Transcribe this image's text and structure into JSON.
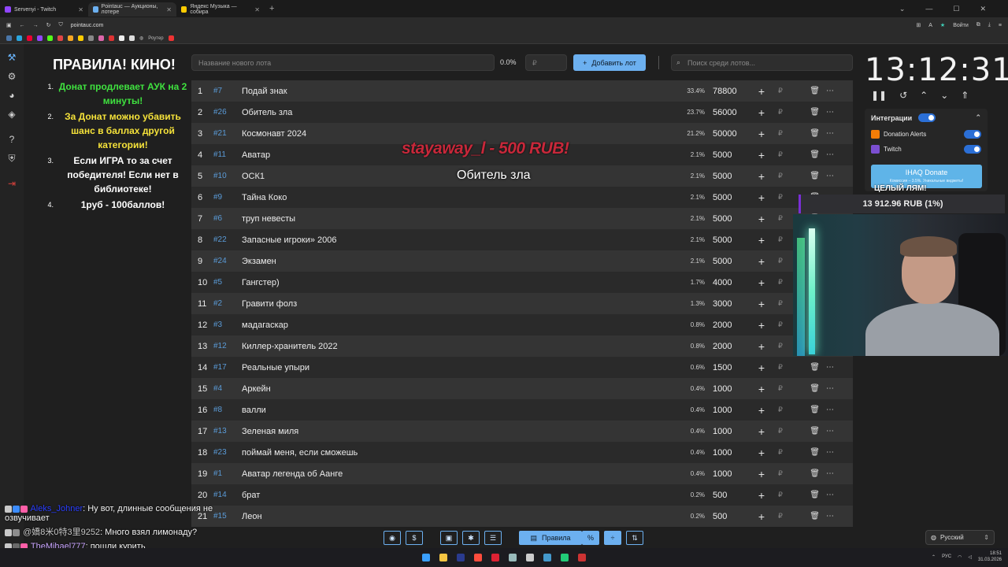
{
  "browser": {
    "tabs": [
      {
        "title": "Servenyi - Twitch",
        "color": "#9146ff",
        "active": false
      },
      {
        "title": "Pointauc — Аукционы, лотере",
        "color": "#6cb0f0",
        "active": true
      },
      {
        "title": "Яндекс Музыка — собира",
        "color": "#ffcc00",
        "active": false
      }
    ],
    "url": "pointauc.com",
    "login_label": "Войти",
    "bookmark_router": "Роутер"
  },
  "rules": {
    "title": "ПРАВИЛА! КИНО!",
    "items": [
      {
        "num": "1.",
        "text": "Донат продлевает АУК на 2 минуты!"
      },
      {
        "num": "2.",
        "text": "За Донат можно убавить шанс в баллах другой категории!"
      },
      {
        "num": "3.",
        "text": "Если ИГРА то за счет победителя! Если нет в библиотеке!"
      },
      {
        "num": "4.",
        "text": "1руб - 100баллов!"
      }
    ]
  },
  "toolbar": {
    "new_lot_placeholder": "Название нового лота",
    "percent": "0.0%",
    "amount_placeholder": "₽",
    "add_button": "Добавить лот",
    "search_placeholder": "Поиск среди лотов..."
  },
  "lots": [
    {
      "rank": "1",
      "id": "#7",
      "name": "Подай знак",
      "chance": "33.4%",
      "sum": "78800"
    },
    {
      "rank": "2",
      "id": "#26",
      "name": "Обитель зла",
      "chance": "23.7%",
      "sum": "56000"
    },
    {
      "rank": "3",
      "id": "#21",
      "name": "Космонавт 2024",
      "chance": "21.2%",
      "sum": "50000"
    },
    {
      "rank": "4",
      "id": "#11",
      "name": "Аватар",
      "chance": "2.1%",
      "sum": "5000"
    },
    {
      "rank": "5",
      "id": "#10",
      "name": "ОСК1",
      "chance": "2.1%",
      "sum": "5000"
    },
    {
      "rank": "6",
      "id": "#9",
      "name": "Тайна Коко",
      "chance": "2.1%",
      "sum": "5000"
    },
    {
      "rank": "7",
      "id": "#6",
      "name": "труп невесты",
      "chance": "2.1%",
      "sum": "5000"
    },
    {
      "rank": "8",
      "id": "#22",
      "name": "Запасные игроки» 2006",
      "chance": "2.1%",
      "sum": "5000"
    },
    {
      "rank": "9",
      "id": "#24",
      "name": "Экзамен",
      "chance": "2.1%",
      "sum": "5000"
    },
    {
      "rank": "10",
      "id": "#5",
      "name": "Гангстер)",
      "chance": "1.7%",
      "sum": "4000"
    },
    {
      "rank": "11",
      "id": "#2",
      "name": "Гравити фолз",
      "chance": "1.3%",
      "sum": "3000"
    },
    {
      "rank": "12",
      "id": "#3",
      "name": "мадагаскар",
      "chance": "0.8%",
      "sum": "2000"
    },
    {
      "rank": "13",
      "id": "#12",
      "name": "Киллер-хранитель 2022",
      "chance": "0.8%",
      "sum": "2000"
    },
    {
      "rank": "14",
      "id": "#17",
      "name": "Реальные упыри",
      "chance": "0.6%",
      "sum": "1500"
    },
    {
      "rank": "15",
      "id": "#4",
      "name": "Аркейн",
      "chance": "0.4%",
      "sum": "1000"
    },
    {
      "rank": "16",
      "id": "#8",
      "name": "валли",
      "chance": "0.4%",
      "sum": "1000"
    },
    {
      "rank": "17",
      "id": "#13",
      "name": "Зеленая миля",
      "chance": "0.4%",
      "sum": "1000"
    },
    {
      "rank": "18",
      "id": "#23",
      "name": "поймай меня, если сможешь",
      "chance": "0.4%",
      "sum": "1000"
    },
    {
      "rank": "19",
      "id": "#1",
      "name": "Аватар легенда об Аанге",
      "chance": "0.4%",
      "sum": "1000"
    },
    {
      "rank": "20",
      "id": "#14",
      "name": "брат",
      "chance": "0.2%",
      "sum": "500"
    },
    {
      "rank": "21",
      "id": "#15",
      "name": "Леон",
      "chance": "0.2%",
      "sum": "500"
    }
  ],
  "overlay": {
    "donation_alert": "stayaway_l - 500 RUB!",
    "winner": "Обитель зла"
  },
  "timer": {
    "value": "13:12:31"
  },
  "integrations": {
    "title": "Интеграции",
    "items": [
      {
        "label": "Donation Alerts",
        "enabled": true
      },
      {
        "label": "Twitch",
        "enabled": true
      }
    ],
    "ihaq_label": "IHAQ Donate",
    "ihaq_sub": "Комиссия – 3.5%. Уникальные виджеты!"
  },
  "goal": {
    "label": "ЦЕЛЫЙ ЛЯМ!",
    "progress": "13 912.96 RUB (1%)"
  },
  "bottom": {
    "rules_button": "Правила",
    "language": "Русский"
  },
  "chat": [
    {
      "user": "Aleks_Johner",
      "text": ": Ну вот, длинные сообщения не озвучивает"
    },
    {
      "user": "@嬌8米0特3里9252",
      "text": ": Много взял лимонаду?"
    },
    {
      "user": "TheMihael777",
      "text": ": пошли курить"
    }
  ],
  "system": {
    "keyboard_layout": "РУС",
    "time": "18:51",
    "date": "31.03.2026"
  }
}
